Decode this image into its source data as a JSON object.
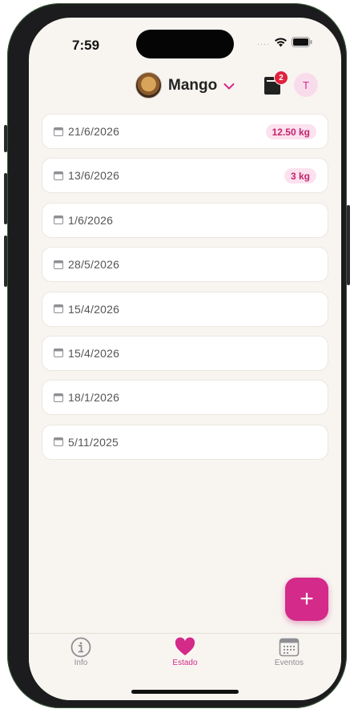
{
  "status": {
    "time": "7:59",
    "signal_dots": "....",
    "wifi_icon": "wifi-icon",
    "battery_icon": "battery-icon"
  },
  "header": {
    "pet_name": "Mango",
    "documents_badge": "2",
    "user_initial": "T"
  },
  "entries": [
    {
      "date": "21/6/2026",
      "weight": "12.50 kg"
    },
    {
      "date": "13/6/2026",
      "weight": "3 kg"
    },
    {
      "date": "1/6/2026",
      "weight": ""
    },
    {
      "date": "28/5/2026",
      "weight": ""
    },
    {
      "date": "15/4/2026",
      "weight": ""
    },
    {
      "date": "15/4/2026",
      "weight": ""
    },
    {
      "date": "18/1/2026",
      "weight": ""
    },
    {
      "date": "5/11/2025",
      "weight": ""
    }
  ],
  "fab": {
    "label": "+"
  },
  "tabs": [
    {
      "label": "Info",
      "icon": "info-icon",
      "active": false
    },
    {
      "label": "Estado",
      "icon": "heart-icon",
      "active": true
    },
    {
      "label": "Eventos",
      "icon": "calendar-icon",
      "active": false
    }
  ],
  "colors": {
    "accent": "#d42a8a",
    "background": "#f8f5f1",
    "badge": "#e0223c",
    "weight_chip_bg": "#fce1ee"
  }
}
